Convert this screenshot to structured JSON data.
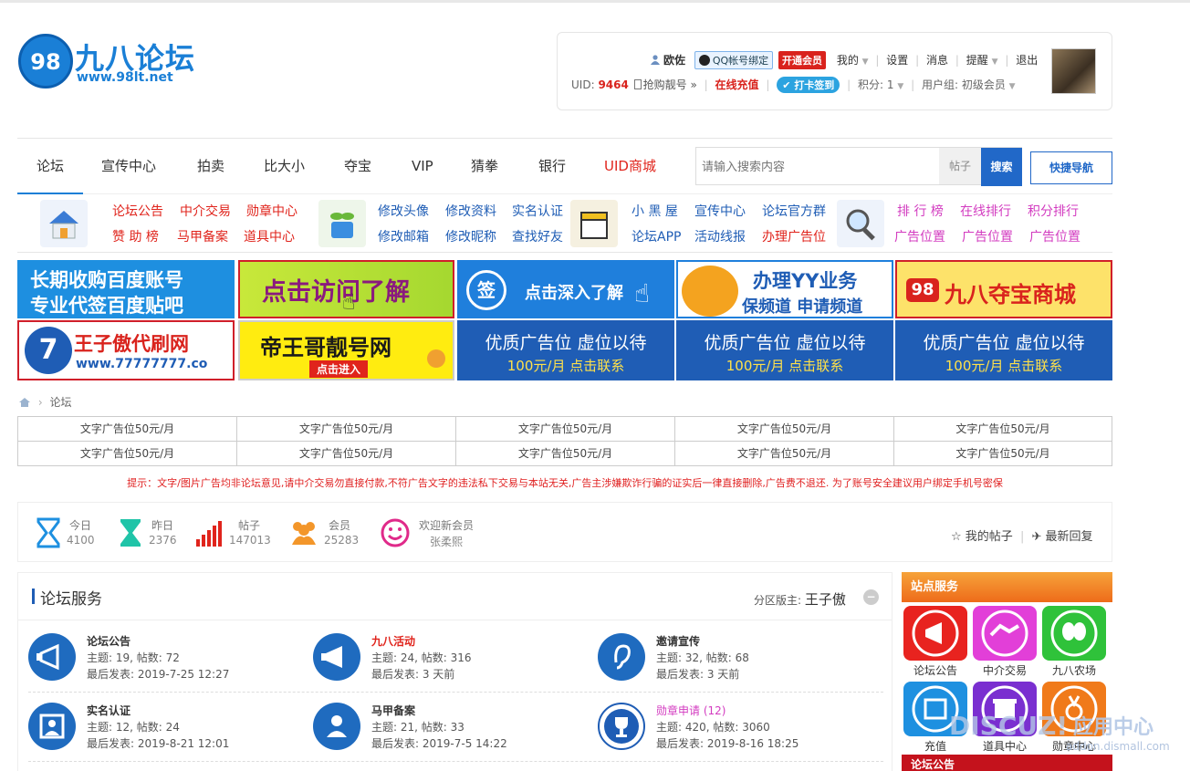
{
  "logo": {
    "mark": "98",
    "title": "九八论坛",
    "url": "www.98lt.net"
  },
  "user": {
    "name": "欧佐",
    "qq_bind": "QQ帐号绑定",
    "vip": "开通会员",
    "menu": [
      "我的",
      "设置",
      "消息",
      "提醒",
      "退出"
    ],
    "uid_label": "UID:",
    "uid": "9464",
    "grab": "抢购靓号 »",
    "recharge": "在线充值",
    "checkin": "打卡签到",
    "points": "积分: 1",
    "group": "用户组: 初级会员"
  },
  "nav": {
    "items": [
      "论坛",
      "宣传中心",
      "拍卖",
      "比大小",
      "夺宝",
      "VIP",
      "猜拳",
      "银行",
      "UID商城"
    ],
    "search_placeholder": "请输入搜索内容",
    "search_type": "帖子",
    "search_button": "搜索",
    "quick_nav": "快捷导航"
  },
  "sublinks": {
    "g1": [
      "论坛公告",
      "中介交易",
      "勋章中心",
      "赞 助 榜",
      "马甲备案",
      "道具中心"
    ],
    "g2": [
      "修改头像",
      "修改资料",
      "实名认证",
      "修改邮箱",
      "修改昵称",
      "查找好友"
    ],
    "g3": [
      "小 黑 屋",
      "宣传中心",
      "论坛官方群",
      "论坛APP",
      "活动线报",
      "办理广告位"
    ],
    "g4": [
      "排 行 榜",
      "在线排行",
      "积分排行",
      "广告位置",
      "广告位置",
      "广告位置"
    ]
  },
  "ads": {
    "a1": [
      "长期收购百度账号",
      "专业代签百度贴吧"
    ],
    "a2": "点击访问了解",
    "a3": "点击深入了解",
    "a4": [
      "办理YY业务",
      "保频道  申请频道"
    ],
    "a5": [
      "98",
      "九八夺宝商城"
    ],
    "b1": [
      "王子傲代刷网",
      "www.77777777.co"
    ],
    "b2": [
      "帝王哥靓号网",
      "点击进入"
    ],
    "b3": [
      "优质广告位 虚位以待",
      "100元/月 点击联系"
    ]
  },
  "breadcrumb": "论坛",
  "text_ads": [
    "文字广告位50元/月",
    "文字广告位50元/月",
    "文字广告位50元/月",
    "文字广告位50元/月",
    "文字广告位50元/月",
    "文字广告位50元/月",
    "文字广告位50元/月",
    "文字广告位50元/月",
    "文字广告位50元/月",
    "文字广告位50元/月"
  ],
  "tip": "提示：文字/图片广告均非论坛意见,请中介交易勿直接付款,不符广告文字的违法私下交易与本站无关,广告主涉嫌欺诈行骗的证实后一律直接删除,广告费不退还. 为了账号安全建议用户绑定手机号密保",
  "stats": {
    "today_label": "今日",
    "today": "4100",
    "yesterday_label": "昨日",
    "yesterday": "2376",
    "posts_label": "帖子",
    "posts": "147013",
    "members_label": "会员",
    "members": "25283",
    "welcome_label": "欢迎新会员",
    "welcome": "张柔熙",
    "my_posts": "我的帖子",
    "latest": "最新回复"
  },
  "forum_service": {
    "title": "论坛服务",
    "moderator_label": "分区版主:",
    "moderator": "王子傲",
    "forums": [
      {
        "name": "论坛公告",
        "stats": "主题: 19, 帖数: 72",
        "last": "最后发表: 2019-7-25 12:27"
      },
      {
        "name": "九八活动",
        "stats": "主题: 24, 帖数: 316",
        "last": "最后发表: 3 天前"
      },
      {
        "name": "邀请宣传",
        "stats": "主题: 32, 帖数: 68",
        "last": "最后发表: 3 天前"
      },
      {
        "name": "实名认证",
        "stats": "主题: 12, 帖数: 24",
        "last": "最后发表: 2019-8-21 12:01"
      },
      {
        "name": "马甲备案",
        "stats": "主题: 21, 帖数: 33",
        "last": "最后发表: 2019-7-5 14:22"
      },
      {
        "name": "勋章申请",
        "count": "(12)",
        "stats": "主题: 420, 帖数: 3060",
        "last": "最后发表: 2019-8-16 18:25"
      }
    ]
  },
  "side": {
    "title": "站点服务",
    "items": [
      "论坛公告",
      "中介交易",
      "九八农场",
      "充值",
      "道具中心",
      "勋章中心"
    ],
    "bottom": "论坛公告"
  },
  "watermark": {
    "text": "DISCUZ!",
    "cn": "应用中心",
    "url": "addon.dismall.com"
  }
}
